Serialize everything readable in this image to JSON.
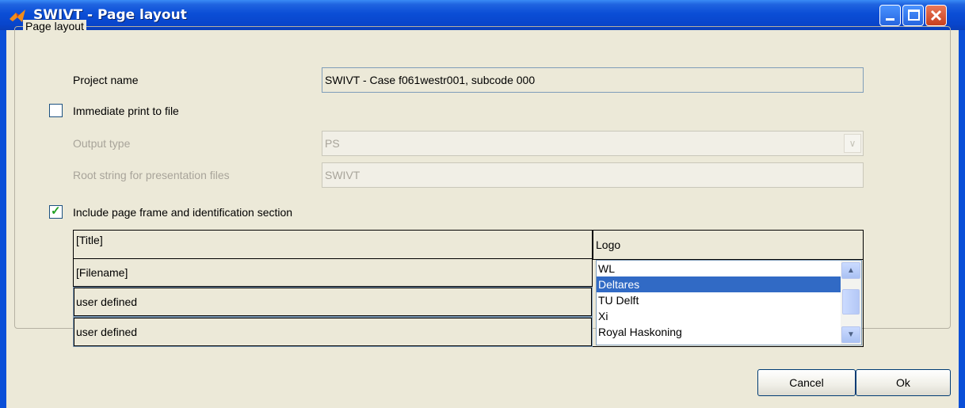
{
  "window": {
    "title": "SWIVT - Page layout",
    "buttons": {
      "minimize": "minimize-icon",
      "maximize": "maximize-icon",
      "close": "close-icon"
    }
  },
  "page_layout": {
    "group_label": "Page layout",
    "project_name": {
      "label": "Project name",
      "value": "SWIVT - Case f061westr001, subcode 000"
    },
    "immediate_print": {
      "label": "Immediate print to file",
      "checked": false
    },
    "output_type": {
      "label": "Output type",
      "value": "PS"
    },
    "root_string": {
      "label": "Root string for presentation files",
      "value": "SWIVT"
    },
    "include_frame": {
      "label": "Include page frame and identification section",
      "checked": true
    }
  },
  "frame_section": {
    "title_field": "[Title]",
    "filename_field": "[Filename]",
    "user_field_1": "user defined",
    "user_field_2": "user defined",
    "logo_label": "Logo",
    "logo_options": [
      "WL",
      "Deltares",
      "TU Delft",
      "Xi",
      "Royal Haskoning"
    ],
    "logo_selected": "Deltares"
  },
  "footer": {
    "cancel_label": "Cancel",
    "ok_label": "Ok"
  },
  "colors": {
    "titlebar": "#0a4fd8",
    "selection": "#316ac5",
    "dialog_bg": "#ece9d8"
  }
}
